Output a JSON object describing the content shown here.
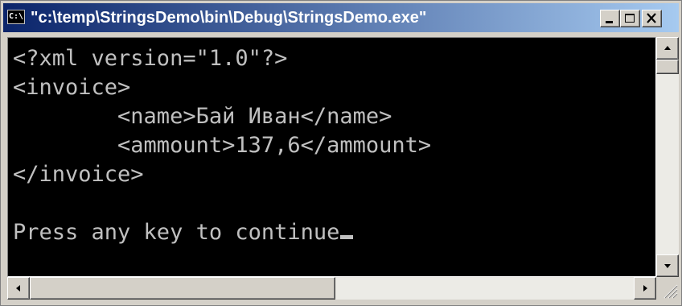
{
  "window": {
    "title": "\"c:\\temp\\StringsDemo\\bin\\Debug\\StringsDemo.exe\"",
    "icon_label": "C:\\",
    "icon": "console-app-icon",
    "buttons": [
      "minimize-icon",
      "maximize-icon",
      "close-icon"
    ]
  },
  "console": {
    "lines": [
      "<?xml version=\"1.0\"?>",
      "<invoice>",
      "        <name>Бай Иван</name>",
      "        <ammount>137,6</ammount>",
      "</invoice>",
      "",
      "Press any key to continue"
    ],
    "text_color": "#c0c0c0",
    "background": "#000000"
  },
  "colors": {
    "titlebar_start": "#0a246a",
    "titlebar_end": "#a6caf0",
    "chrome": "#d4d0c8"
  }
}
